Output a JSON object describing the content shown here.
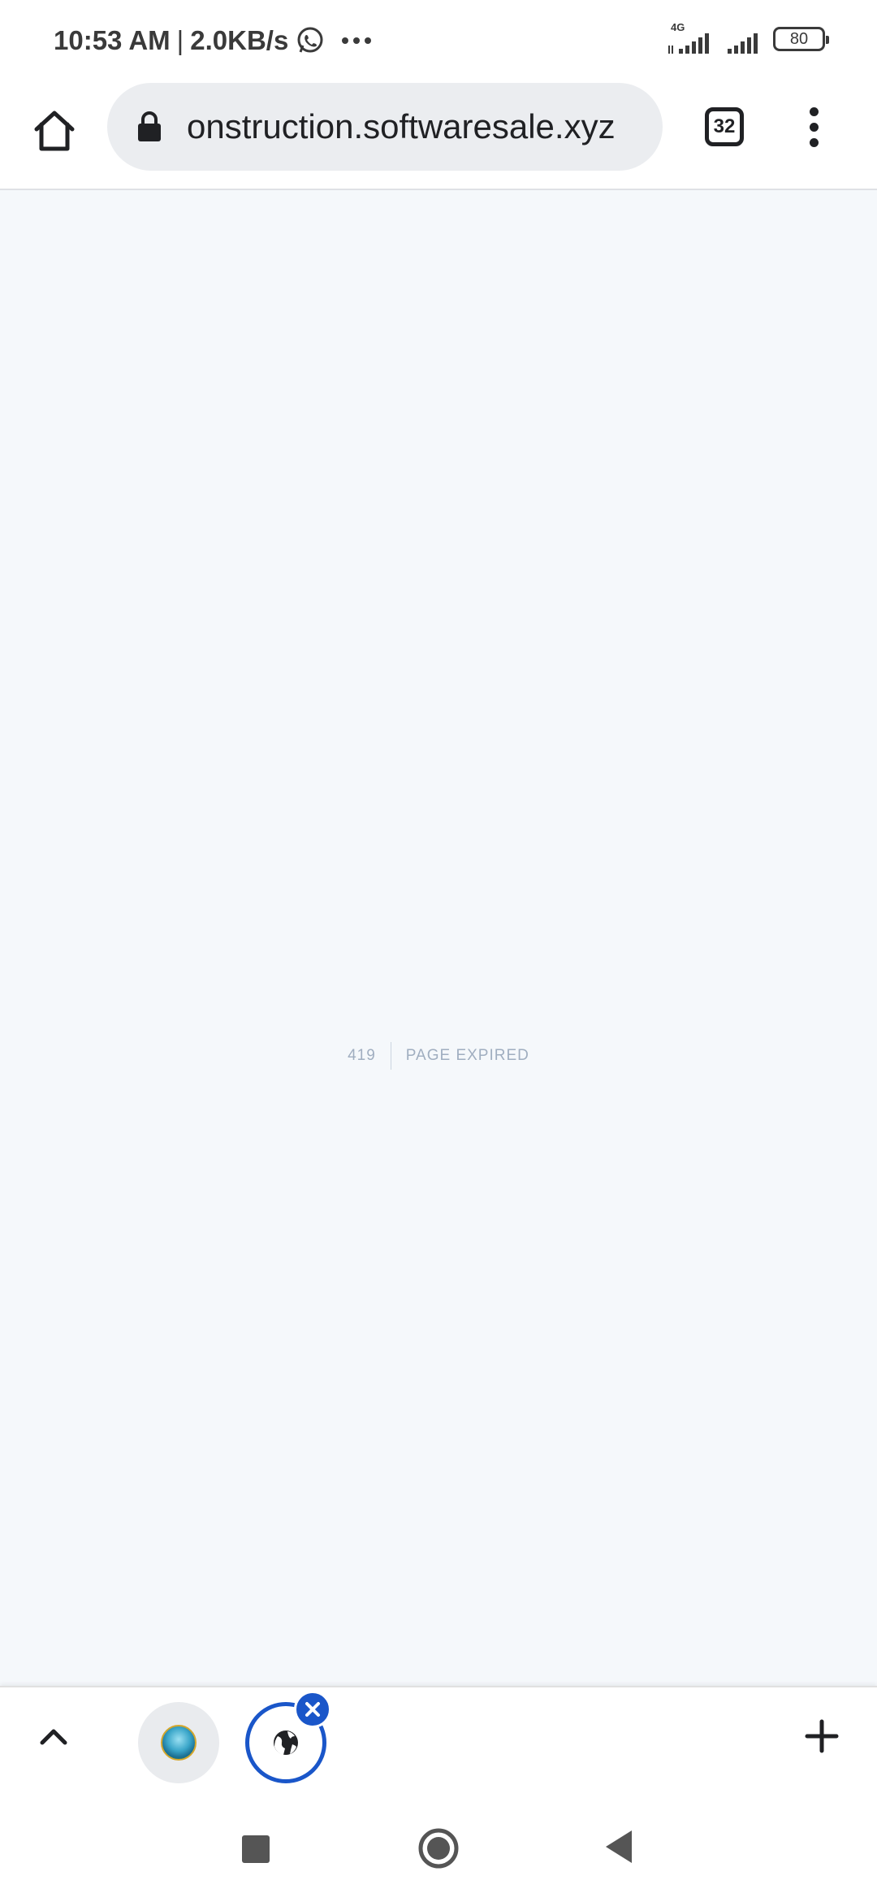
{
  "status_bar": {
    "time": "10:53 AM",
    "separator": "|",
    "speed": "2.0KB/s",
    "network_type": "4G",
    "battery": "80"
  },
  "browser": {
    "url": "onstruction.softwaresale.xyz",
    "tab_count": "32"
  },
  "page": {
    "error_code": "419",
    "error_message": "PAGE EXPIRED",
    "background_color": "#f5f8fb",
    "text_color": "#a0aec0"
  },
  "tab_strip": {
    "active_tab_color": "#1a56c9",
    "icons": [
      "chevron-up-icon",
      "site-logo-icon",
      "globe-icon",
      "close-icon",
      "plus-icon"
    ]
  },
  "nav_bar": {
    "icons": [
      "recents-square-icon",
      "home-circle-icon",
      "back-triangle-icon"
    ]
  }
}
